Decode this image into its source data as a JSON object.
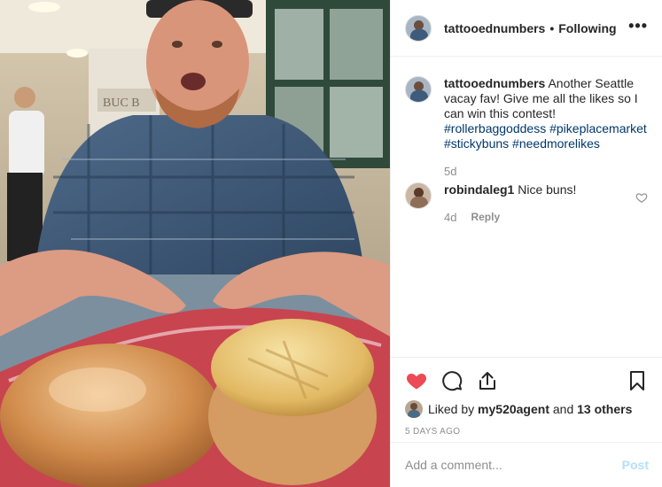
{
  "header": {
    "username": "tattooednumbers",
    "separator": "•",
    "following_label": "Following",
    "more_icon": "more-horizontal-icon",
    "more_glyph": "•••"
  },
  "photo": {
    "description_icon": "post-photo",
    "sign_text": "BUC B"
  },
  "caption": {
    "username": "tattooednumbers",
    "text": "Another Seattle vacay fav! Give me all the likes so I can win this contest!",
    "hashtags": [
      "#rollerbaggoddess",
      "#pikeplacemarket",
      "#stickybuns",
      "#needmorelikes"
    ],
    "age": "5d"
  },
  "comments": [
    {
      "username": "robindaleg1",
      "text": "Nice buns!",
      "age": "4d",
      "reply_label": "Reply"
    }
  ],
  "actions": {
    "like_icon": "heart-filled-icon",
    "comment_icon": "comment-icon",
    "share_icon": "share-icon",
    "save_icon": "bookmark-icon",
    "like_color": "#ed4956"
  },
  "likes": {
    "prefix": "Liked by ",
    "user": "my520agent",
    "middle": " and ",
    "others": "13 others"
  },
  "timestamp": "5 DAYS AGO",
  "add_comment": {
    "placeholder": "Add a comment...",
    "post_label": "Post",
    "post_color": "#b2dffc"
  }
}
